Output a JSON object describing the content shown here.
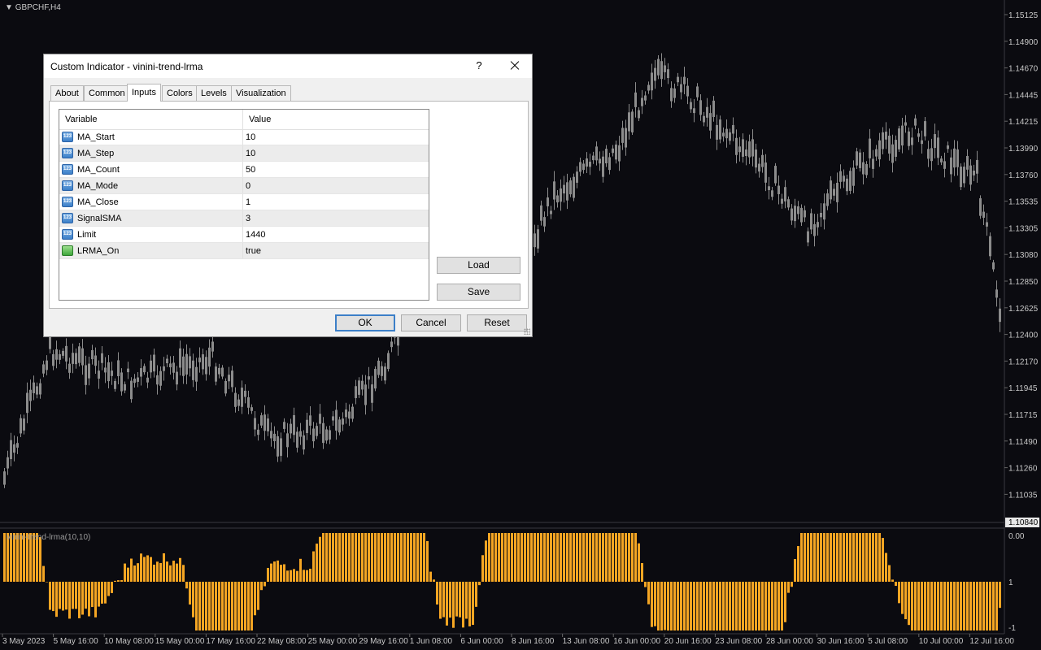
{
  "chart": {
    "symbol": "GBPCHF,H4",
    "indicator_label": "vinini-trend-lrma(10,10)",
    "price_axis": [
      "1.15125",
      "1.14900",
      "1.14670",
      "1.14445",
      "1.14215",
      "1.13990",
      "1.13760",
      "1.13535",
      "1.13305",
      "1.13080",
      "1.12850",
      "1.12625",
      "1.12400",
      "1.12170",
      "1.11945",
      "1.11715",
      "1.11490",
      "1.11260",
      "1.11035"
    ],
    "current_price": "1.10840",
    "ind_axis": [
      "1",
      "0.00",
      "-1"
    ],
    "time_axis": [
      "3 May 2023",
      "5 May 16:00",
      "10 May 08:00",
      "15 May 00:00",
      "17 May 16:00",
      "22 May 08:00",
      "25 May 00:00",
      "29 May 16:00",
      "1 Jun 08:00",
      "6 Jun 00:00",
      "8 Jun 16:00",
      "13 Jun 08:00",
      "16 Jun 00:00",
      "20 Jun 16:00",
      "23 Jun 08:00",
      "28 Jun 00:00",
      "30 Jun 16:00",
      "5 Jul 08:00",
      "10 Jul 00:00",
      "12 Jul 16:00"
    ],
    "colors": {
      "bg": "#0b0b10",
      "candle": "#8c8c8c",
      "histogram": "#f5a623",
      "axis_text": "#c8c8c8"
    }
  },
  "dialog": {
    "title": "Custom Indicator - vinini-trend-lrma",
    "help_label": "?",
    "tabs": [
      "About",
      "Common",
      "Inputs",
      "Colors",
      "Levels",
      "Visualization"
    ],
    "active_tab": "Inputs",
    "columns": {
      "variable": "Variable",
      "value": "Value"
    },
    "inputs": [
      {
        "name": "MA_Start",
        "value": "10",
        "icon": "number-icon"
      },
      {
        "name": "MA_Step",
        "value": "10",
        "icon": "number-icon"
      },
      {
        "name": "MA_Count",
        "value": "50",
        "icon": "number-icon"
      },
      {
        "name": "MA_Mode",
        "value": "0",
        "icon": "number-icon"
      },
      {
        "name": "MA_Close",
        "value": "1",
        "icon": "number-icon"
      },
      {
        "name": "SignalSMA",
        "value": "3",
        "icon": "number-icon"
      },
      {
        "name": "Limit",
        "value": "1440",
        "icon": "number-icon"
      },
      {
        "name": "LRMA_On",
        "value": "true",
        "icon": "bool-icon"
      }
    ],
    "load_label": "Load",
    "save_label": "Save",
    "ok_label": "OK",
    "cancel_label": "Cancel",
    "reset_label": "Reset"
  }
}
